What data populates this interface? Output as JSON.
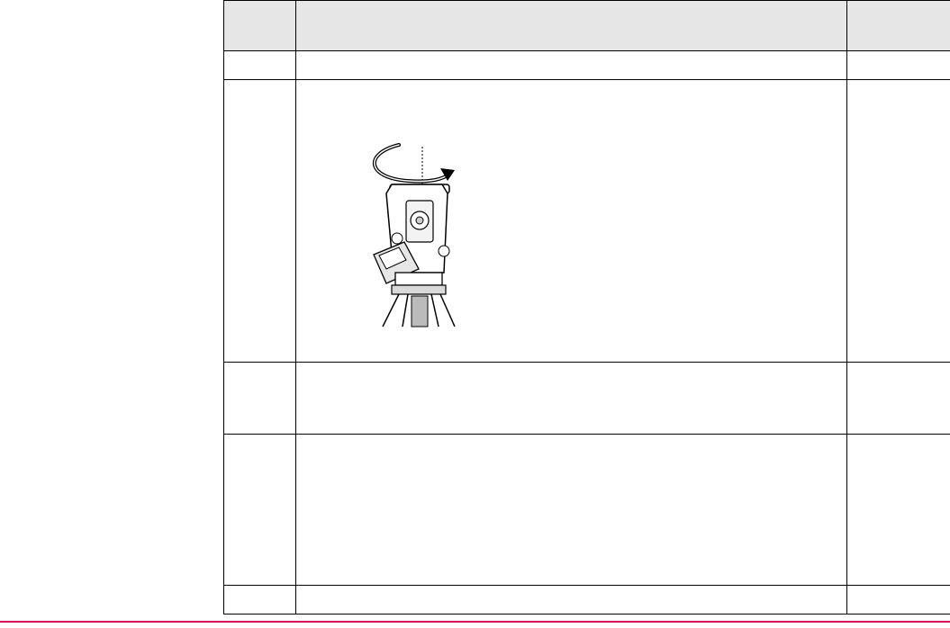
{
  "table": {
    "headers": [
      "",
      "",
      ""
    ],
    "rows": [
      {
        "cells": [
          "",
          "",
          ""
        ]
      },
      {
        "cells": [
          "",
          "",
          ""
        ],
        "illustration": "total-station-rotation"
      },
      {
        "cells": [
          "",
          "",
          ""
        ]
      },
      {
        "cells": [
          "",
          "",
          ""
        ]
      },
      {
        "cells": [
          "",
          "",
          ""
        ]
      }
    ]
  },
  "footer": {
    "rule_color": "#d10a5a"
  }
}
